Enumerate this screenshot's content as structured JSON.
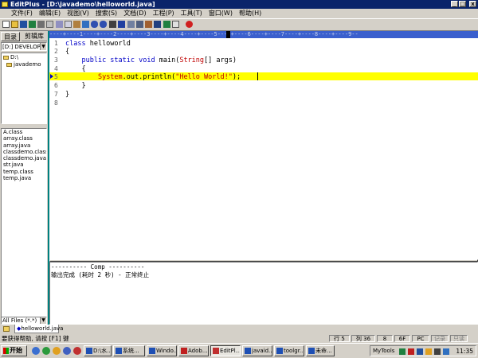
{
  "window": {
    "title": "EditPlus - [D:\\javademo\\helloworld.java]",
    "buttons": {
      "minimize": "_",
      "maximize": "□",
      "close": "x"
    }
  },
  "menu": [
    "文件(F)",
    "编辑(E)",
    "视图(V)",
    "搜索(S)",
    "文档(D)",
    "工程(P)",
    "工具(T)",
    "窗口(W)",
    "帮助(H)"
  ],
  "left_panel": {
    "tabs": [
      "目录",
      "剪辑库"
    ],
    "drive": "[D:] DEVELOPE",
    "folders": [
      "D:\\",
      "javademo"
    ],
    "files": [
      "A.class",
      "array.class",
      "array.java",
      "classdemo.class",
      "classdemo.java",
      "str.java",
      "temp.class",
      "temp.java"
    ],
    "filter": "All Files (*.*)"
  },
  "editor": {
    "ruler": "----+----1----+----2----+----3----+----4----+----5----+----6----+----7----+----8----+----9--",
    "line_numbers": [
      "1",
      "2",
      "3",
      "4",
      "5",
      "6",
      "7",
      "8"
    ],
    "code": {
      "l1_kw": "class",
      "l1_rest": " helloworld",
      "l2": "{",
      "l3_indent": "    ",
      "l3_kw": "public static void",
      "l3_mid": " main(",
      "l3_type": "String",
      "l3_rest": "[] args)",
      "l4": "    {",
      "l5_indent": "        ",
      "l5_sys": "System",
      "l5_mid": ".out.println(",
      "l5_str": "\"Hello World!\"",
      "l5_rest": ");",
      "l6": "    }",
      "l7": "}"
    }
  },
  "output": {
    "header": "---------- Comp ----------",
    "message": "输出完成 (耗时 2 秒) - 正常终止"
  },
  "doc_tab": "helloworld.java",
  "status": {
    "message": "要获得帮助, 请按 [F1] 键",
    "row": "行 5",
    "col": "列 36",
    "num1": "8",
    "num2": "6F",
    "pc": "PC",
    "rec": "记录",
    "rdonly": "只读"
  },
  "taskbar": {
    "start": "开始",
    "tasks": [
      "D:\\水...",
      "系统...",
      "Windo...",
      "Adob...",
      "EditPl...",
      "javaid...",
      "toolgr...",
      "未命..."
    ],
    "mytools": "MyTools",
    "clock": "11:35"
  }
}
